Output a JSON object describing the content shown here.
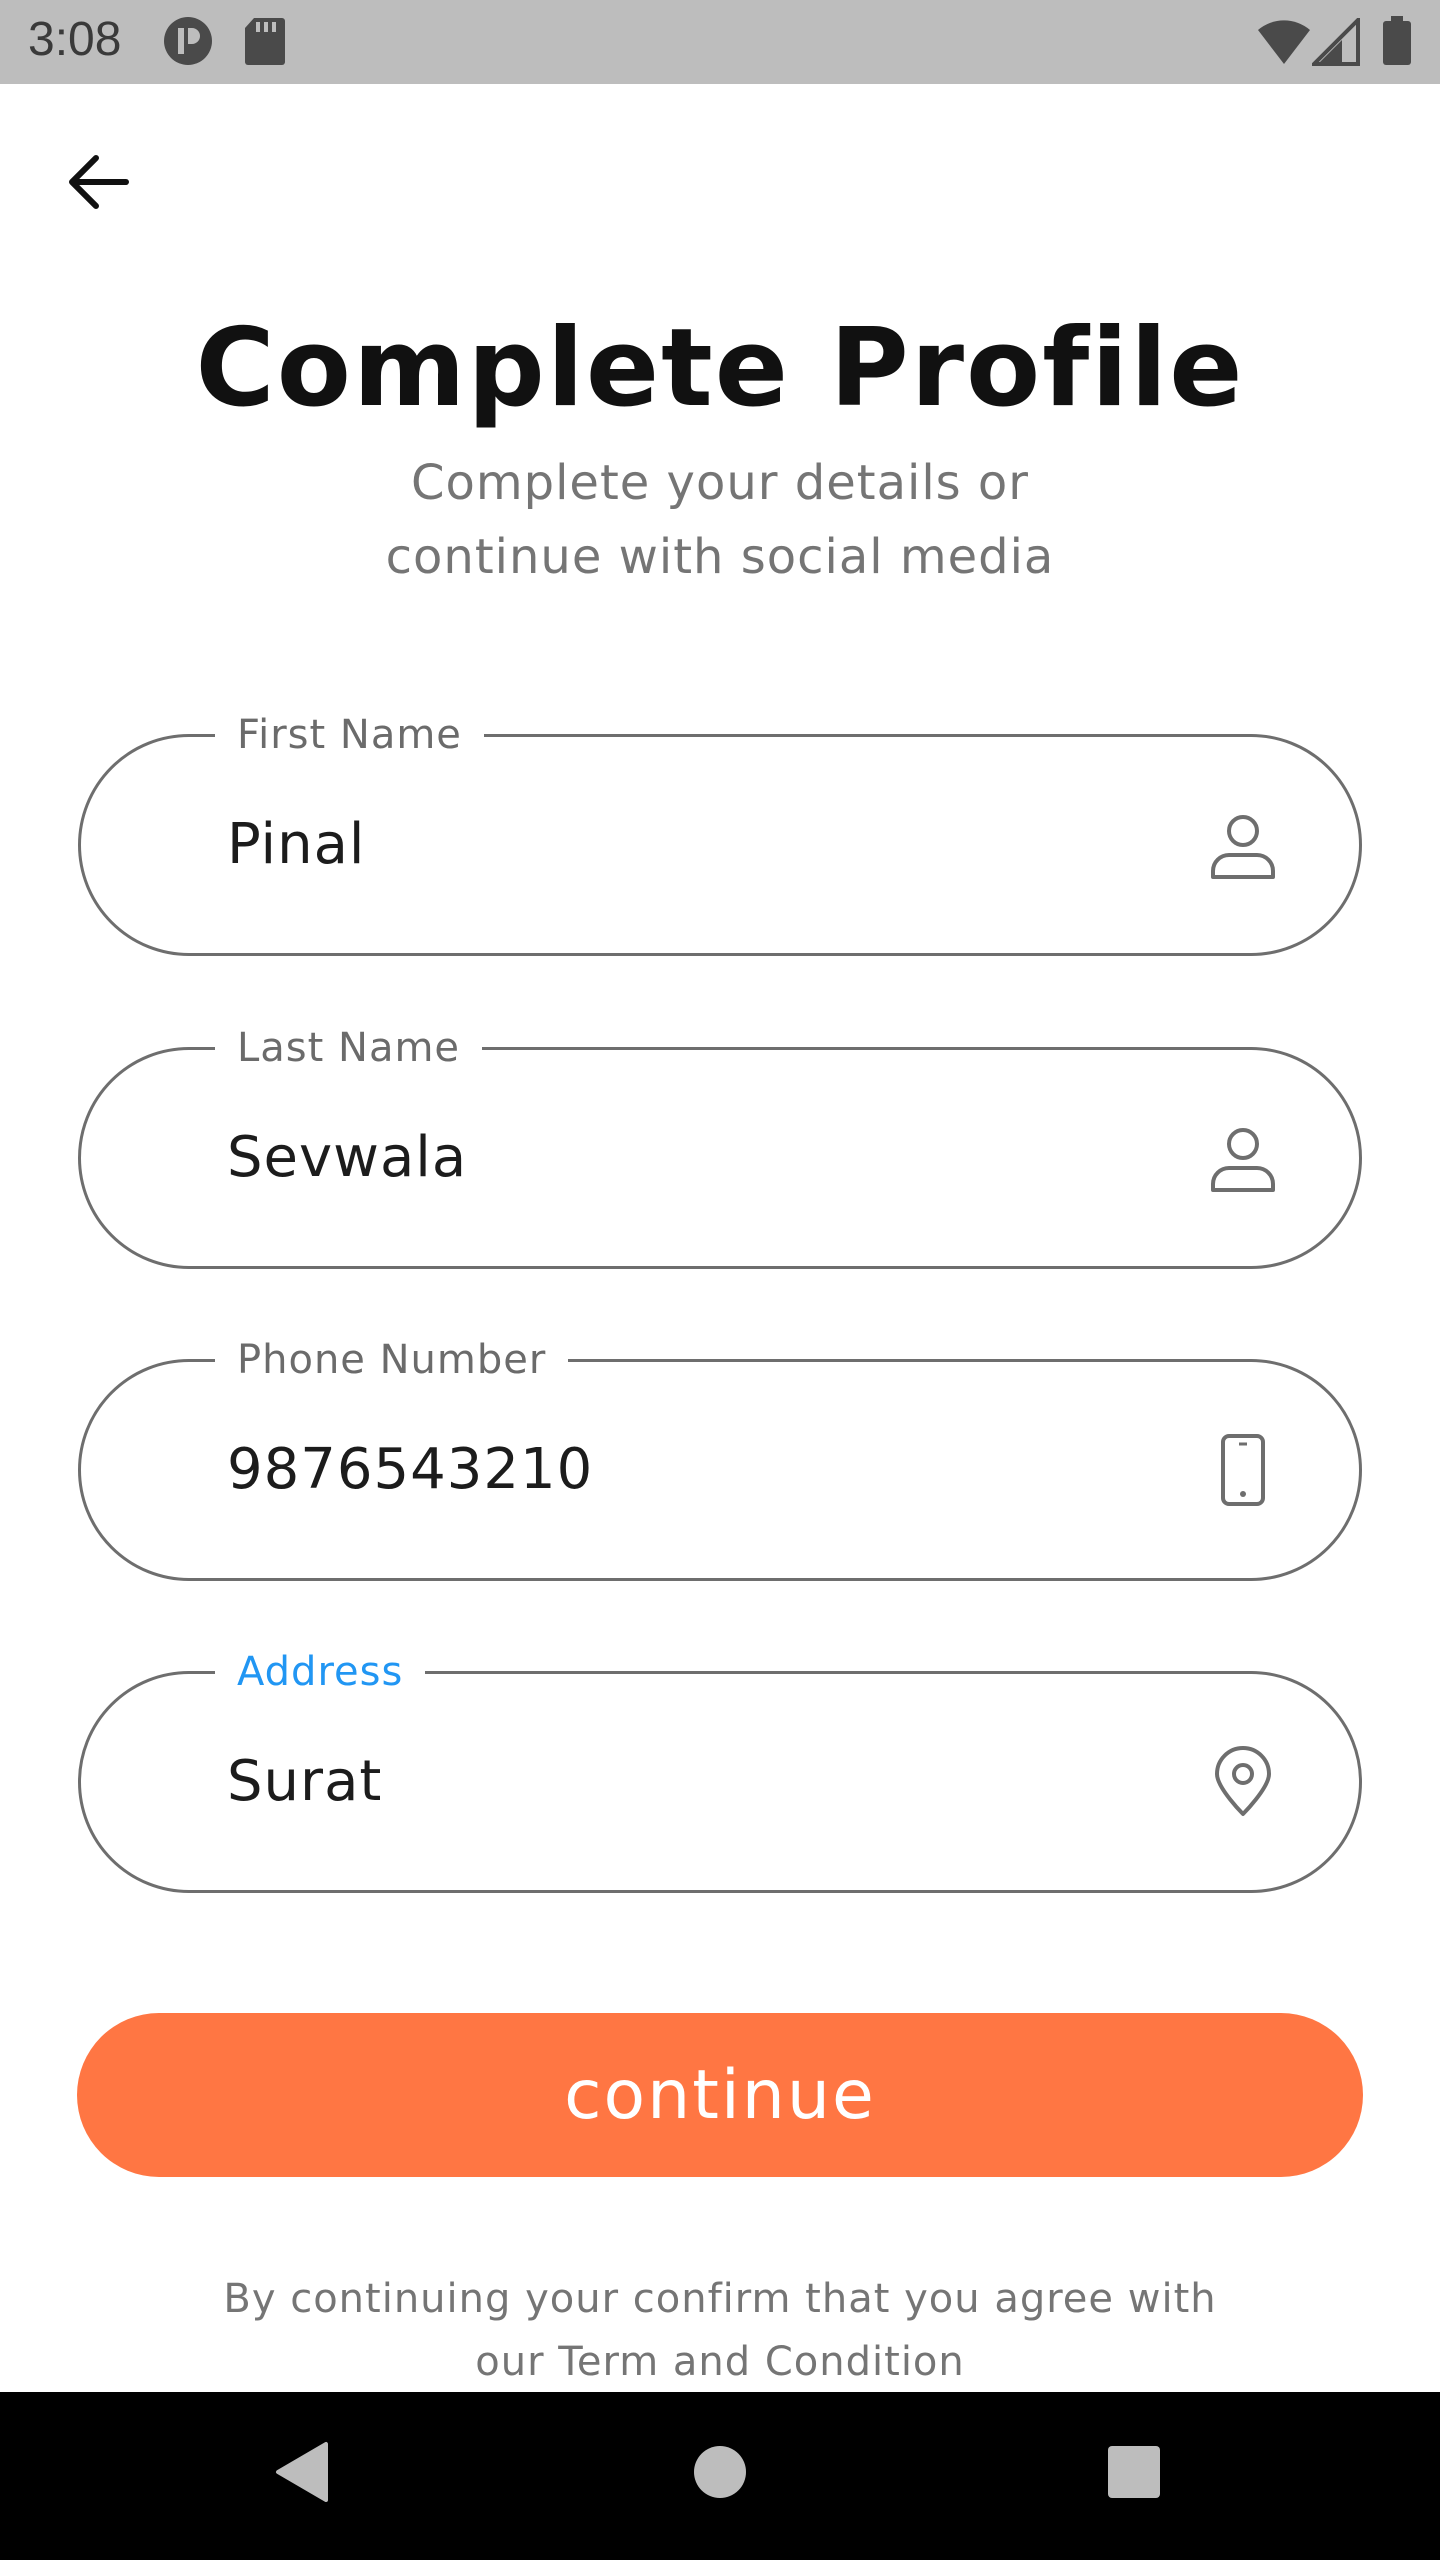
{
  "status_bar": {
    "time": "3:08",
    "icons": [
      "app-notification-icon",
      "sd-card-icon",
      "wifi-icon",
      "cell-signal-icon",
      "battery-icon"
    ]
  },
  "header": {
    "back_icon": "arrow-left-icon",
    "title": "Complete Profile",
    "subtitle": "Complete your details or continue with social media"
  },
  "form": {
    "first_name": {
      "label": "First Name",
      "value": "Pinal",
      "icon": "user-icon"
    },
    "last_name": {
      "label": "Last Name",
      "value": "Sevwala",
      "icon": "user-icon"
    },
    "phone": {
      "label": "Phone Number",
      "value": "9876543210",
      "icon": "phone-icon"
    },
    "address": {
      "label": "Address",
      "value": "Surat",
      "icon": "location-pin-icon",
      "focused": true
    }
  },
  "continue_label": "continue",
  "terms_text": "By continuing your confirm that you agree with our Term and Condition",
  "colors": {
    "accent": "#ff7643",
    "focus_label": "#2196f3",
    "status_bar": "#bdbdbd",
    "nav_bar": "#000000"
  }
}
